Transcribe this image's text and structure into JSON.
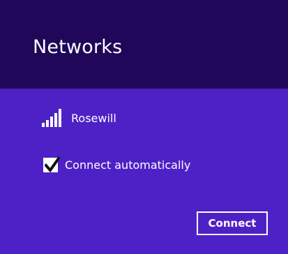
{
  "header": {
    "title": "Networks"
  },
  "network": {
    "name": "Rosewill",
    "icon": "wifi-signal-icon",
    "signal_bars": 5,
    "signal_bars_filled": 5
  },
  "auto_connect": {
    "label": "Connect automatically",
    "checked": true
  },
  "actions": {
    "connect_label": "Connect"
  },
  "colors": {
    "header_bg": "#20075a",
    "panel_bg": "#4e21c6",
    "text": "#ffffff"
  }
}
